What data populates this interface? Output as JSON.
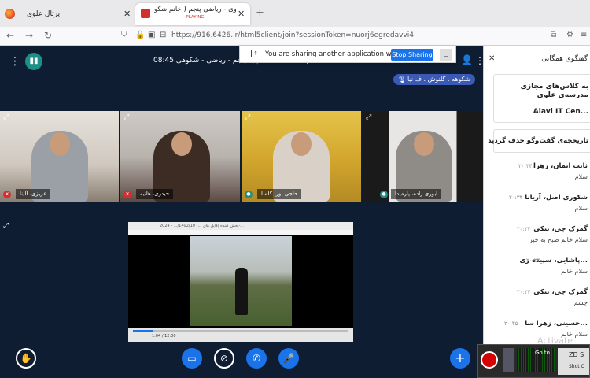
{
  "browser": {
    "tabs": [
      {
        "title": "پرتال علوی",
        "active": false
      },
      {
        "title": "علوی - ریاضی پنجم ( خانم شکو...",
        "subtitle": "PLAYING",
        "active": true
      }
    ],
    "url": "https://916.6426.ir/html5client/join?sessionToken=nuorj6egredavvi4"
  },
  "meeting": {
    "session_title": "08:45 تا 08:00 | 1403/10/0... پایه پنجم - ریاضی - شکوهی (...)",
    "share_banner_text": "You are sharing another application window.",
    "stop_sharing_label": "Stop Sharing",
    "minimize_label": "_",
    "talking_indicator": "شکوهه ، گلنوش ، ف نیا",
    "participants": [
      {
        "name": "عزیزی، آلینا",
        "mic": "muted"
      },
      {
        "name": "حیدری، هانیه",
        "mic": "muted"
      },
      {
        "name": "حاجی نور، گلسا",
        "mic": "on"
      },
      {
        "name": "ابوری زاده، پارمیدا",
        "mic": "on"
      }
    ],
    "screenshare": {
      "window_title": "پخش کننده (فایل های ...) 1402/10/... - 2024-...",
      "player_time": "1:04 / 12:00",
      "progress_fraction": 0.09
    }
  },
  "chat": {
    "title": "گفتگوی همگانی",
    "welcome_lines": [
      "به کلاس‌های مجازی",
      "مدرسه‌ی علوی",
      "Alavi IT Cen..."
    ],
    "cleared_text": "تاریخچه‌ی گفت‌وگو حذف گردید",
    "messages": [
      {
        "name": "ثابت ایمان، زهرا",
        "time": "۲۰:۳۴",
        "text": "سلام"
      },
      {
        "name": "شکوری اصل، آریانا",
        "time": "۲۰:۳۴",
        "text": "سلام"
      },
      {
        "name": "گمرک چی، نیکی",
        "time": "۲۰:۳۴",
        "text": "سلام خانم صبح به خیر"
      },
      {
        "name": "پاشایی، سپیده ری...",
        "time": "۲۰:۳۴",
        "text": "سلام خانم"
      },
      {
        "name": "گمرک چی، نیکی",
        "time": "۲۰:۳۴",
        "text": "چشم"
      },
      {
        "name": "حسینی، زهرا سا...",
        "time": "۲۰:۳۵",
        "text": "سلام خانم"
      }
    ],
    "watermark": "Activate"
  },
  "recorder_overlay": {
    "label": "Go to",
    "box_title": "ZD S",
    "box_subtitle": "Shot O"
  }
}
